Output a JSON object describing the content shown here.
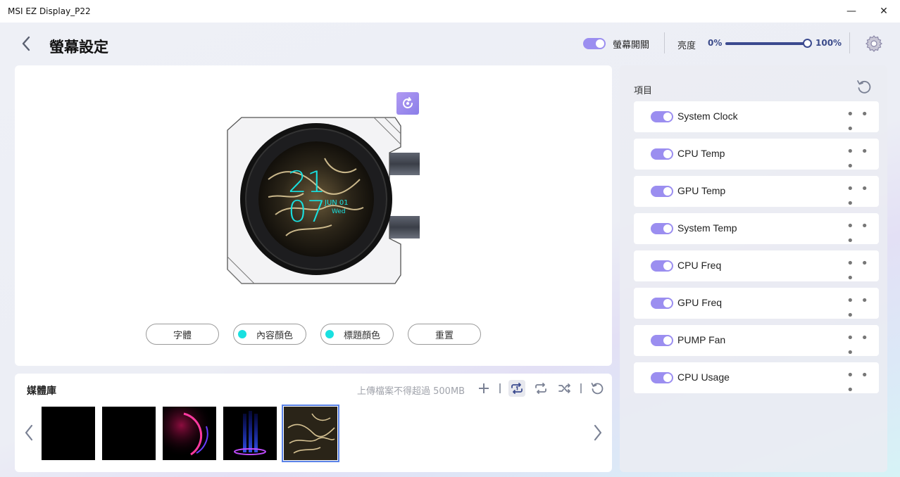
{
  "window": {
    "title": "MSI EZ Display_P22",
    "minimize_glyph": "—",
    "close_glyph": "✕"
  },
  "header": {
    "title": "螢幕設定",
    "screen_toggle_label": "螢幕開關",
    "screen_toggle_on": true,
    "brightness_label": "亮度",
    "brightness_min": "0%",
    "brightness_max": "100%",
    "brightness_value": 100
  },
  "preview": {
    "clock_hour": "21",
    "clock_minute": "07",
    "clock_side_top": "JUN 01",
    "clock_side_bottom": "Wed",
    "buttons": {
      "font": "字體",
      "content_color": "內容顏色",
      "title_color": "標題顏色",
      "reset": "重置"
    },
    "content_color": "#19e0e0",
    "title_color": "#19e0e0"
  },
  "media": {
    "title": "媒體庫",
    "upload_hint": "上傳檔案不得超過 500MB",
    "icons": [
      "add-icon",
      "repeat-one-icon",
      "repeat-icon",
      "shuffle-icon",
      "reset-icon"
    ],
    "thumbnails": [
      "black",
      "black",
      "neon-ring",
      "blue-stage",
      "dragon"
    ],
    "selected_index": 4
  },
  "items": {
    "label": "項目",
    "list": [
      {
        "label": "System Clock",
        "on": true
      },
      {
        "label": "CPU Temp",
        "on": true
      },
      {
        "label": "GPU Temp",
        "on": true
      },
      {
        "label": "System Temp",
        "on": true
      },
      {
        "label": "CPU Freq",
        "on": true
      },
      {
        "label": "GPU Freq",
        "on": true
      },
      {
        "label": "PUMP Fan",
        "on": true
      },
      {
        "label": "CPU Usage",
        "on": true
      }
    ],
    "more_glyph": "• • •"
  },
  "colors": {
    "accent": "#9b8ef0",
    "slider": "#3b4a8f",
    "selected_outline": "#5a82e6"
  }
}
